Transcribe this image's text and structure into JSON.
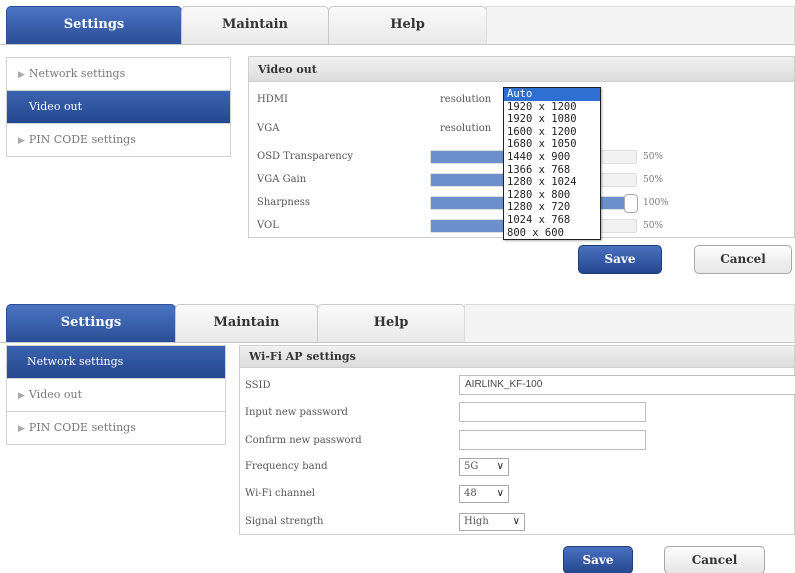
{
  "panel1": {
    "tabs": [
      "Settings",
      "Maintain",
      "Help"
    ],
    "sidebar": [
      {
        "label": "Network settings"
      },
      {
        "label": "Video out"
      },
      {
        "label": "PIN CODE settings"
      }
    ],
    "header": "Video out",
    "hdmi": {
      "label": "HDMI",
      "resolution_label": "resolution"
    },
    "vga": {
      "label": "VGA",
      "resolution_label": "resolution"
    },
    "sliders": [
      {
        "label": "OSD Transparency",
        "value": 50,
        "text": "50%"
      },
      {
        "label": "VGA Gain",
        "value": 50,
        "text": "50%"
      },
      {
        "label": "Sharpness",
        "value": 100,
        "text": "100%"
      },
      {
        "label": "VOL",
        "value": 50,
        "text": "50%"
      }
    ],
    "resolution_options": [
      "Auto",
      "1920 x 1200",
      "1920 x 1080",
      "1600 x 1200",
      "1680 x 1050",
      "1440 x 900",
      "1366 x 768",
      "1280 x 1024",
      "1280 x 800",
      "1280 x 720",
      "1024 x 768",
      "800 x 600"
    ],
    "selected_option": "Auto",
    "save_label": "Save",
    "cancel_label": "Cancel"
  },
  "panel2": {
    "tabs": [
      "Settings",
      "Maintain",
      "Help"
    ],
    "sidebar": [
      {
        "label": "Network settings"
      },
      {
        "label": "Video out"
      },
      {
        "label": "PIN CODE settings"
      }
    ],
    "header": "Wi-Fi AP settings",
    "ssid": {
      "label": "SSID",
      "value": "AIRLINK_KF-100"
    },
    "new_password": {
      "label": "Input new password",
      "value": ""
    },
    "confirm_password": {
      "label": "Confirm new password",
      "value": ""
    },
    "frequency_band": {
      "label": "Frequency band",
      "value": "5G"
    },
    "wifi_channel": {
      "label": "Wi-Fi channel",
      "value": "48"
    },
    "signal_strength": {
      "label": "Signal strength",
      "value": "High"
    },
    "save_label": "Save",
    "cancel_label": "Cancel"
  },
  "colors": {
    "accent": "#2b4f96",
    "slider_fill": "#6d8fcb",
    "dropdown_highlight": "#2f6fd2"
  },
  "icons": {
    "sidebar_arrow": "triangle-right-icon",
    "select_chevron": "chevron-down-icon"
  }
}
